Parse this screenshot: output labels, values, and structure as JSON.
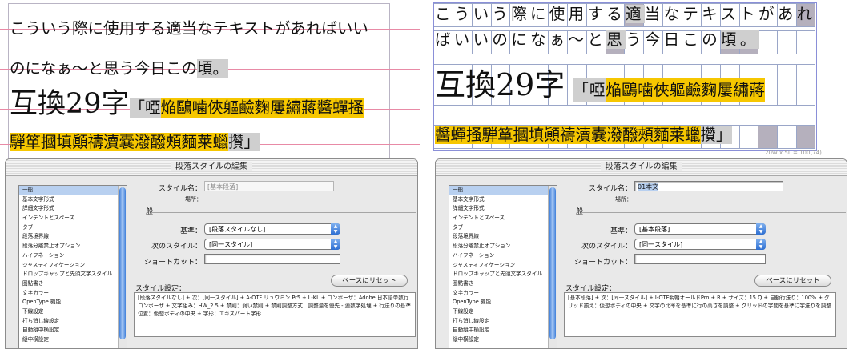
{
  "left": {
    "line1": "こういう際に使用する適当なテキストがあればいい",
    "line2_main": "のになぁ〜と思う今日この",
    "line2_gray": "頃。",
    "line3_plain": "互換29字",
    "line3_gray": "「啞",
    "line3_yellow": "焔鷗噛俠軀鹼麴屢繡蔣醬蟬掻",
    "line4_yellow": "騨箪摑填顚禱瀆嚢潑醱頰麵莱蠟",
    "line4_gray": "攢」",
    "dialog": {
      "title": "段落スタイルの編集",
      "sidebar_items": [
        "一般",
        "基本文字形式",
        "詳細文字形式",
        "インデントとスペース",
        "タブ",
        "段落境界線",
        "段落分離禁止オプション",
        "ハイフネーション",
        "ジャスティフィケーション",
        "ドロップキャップと先頭文字スタイル",
        "圏點書き",
        "文字カラー",
        "OpenType 機能",
        "下線設定",
        "打ち消し線設定",
        "自動縦中横設定",
        "縦中横設定"
      ],
      "style_name_label": "スタイル名：",
      "style_name_value": "[基本段落]",
      "location_label": "場所：",
      "section_general": "一般",
      "based_on_label": "基準：",
      "based_on_value": "[段落スタイルなし]",
      "next_style_label": "次のスタイル：",
      "next_style_value": "[同一スタイル]",
      "shortcut_label": "ショートカット：",
      "shortcut_value": "",
      "reset_button": "ベースにリセット",
      "style_settings_label": "スタイル設定：",
      "style_settings_text": "[段落スタイルなし] + 次：[同一スタイル] + A-OTF リュウミン Pr5 + L-KL + コンポーザ：Adobe 日本語単数行コンポーザ + 文字組み：HW_2.5 + 禁則：弱い禁則 + 禁則調整方式：調整量を優先 - 連数字処理 + 行送りの基準位置：仮想ボディの中央 + 字形：エキスパート字形"
    }
  },
  "right": {
    "line1_a": "こういう際に使用する",
    "line1_gray": "適",
    "line1_b": "当なテキストがあれ",
    "line2_a": "ばいいのになぁ〜と",
    "line2_gray": "思",
    "line2_b": "う今日この",
    "line2_gray2": "頃。",
    "line3_plain": "互換29字",
    "line3_gray": "「啞",
    "line3_yellow": "焔鷗噛俠軀鹼麴屢繡蔣",
    "line4_yellow": "醬蟬掻騨箪摑填顚禱瀆嚢潑醱頰麵莱蠟",
    "line4_gray": "攢」",
    "grid_note": "20W x 5L = 100(74)",
    "dialog": {
      "title": "段落スタイルの編集",
      "sidebar_items": [
        "一般",
        "基本文字形式",
        "詳細文字形式",
        "インデントとスペース",
        "タブ",
        "段落境界線",
        "段落分離禁止オプション",
        "ハイフネーション",
        "ジャスティフィケーション",
        "ドロップキャップと先頭文字スタイル",
        "圏點書き",
        "文字カラー",
        "OpenType 機能",
        "下線設定",
        "打ち消し線設定",
        "自動縦中横設定",
        "縦中横設定"
      ],
      "style_name_label": "スタイル名：",
      "style_name_value": "01本文",
      "location_label": "場所：",
      "section_general": "一般",
      "based_on_label": "基準：",
      "based_on_value": "[基本段落]",
      "next_style_label": "次のスタイル：",
      "next_style_value": "[同一スタイル]",
      "shortcut_label": "ショートカット：",
      "shortcut_value": "",
      "reset_button": "ベースにリセット",
      "style_settings_label": "スタイル設定：",
      "style_settings_text": "[基本段落] + 次：[同一スタイル] + I-OTF明朝オールドPro + R + サイズ：15 Q + 自動行送り：100% + グリッド揃え：仮想ボディの中央 + 文字の比率を基準に行の高さを調整 + グリッドの字間を基準に字送りを調整"
    }
  },
  "colors": {
    "highlight_yellow": "#f6c700",
    "highlight_gray": "#cfcfcf",
    "baseline_pink": "#e88aa6",
    "grid_blue": "#9aa6c8",
    "selection_blue": "#b8d0f0"
  }
}
